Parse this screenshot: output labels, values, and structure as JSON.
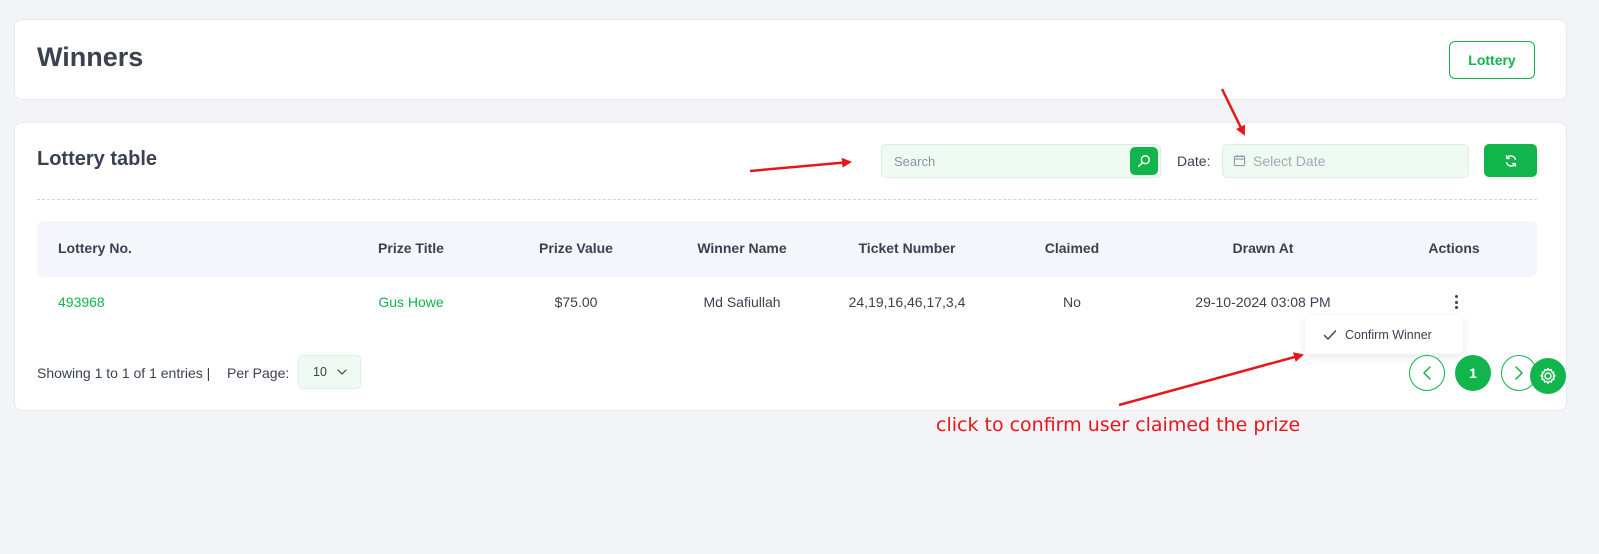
{
  "header": {
    "title": "Winners",
    "lottery_button": "Lottery"
  },
  "table_card": {
    "title": "Lottery table",
    "search_placeholder": "Search",
    "date_label": "Date:",
    "date_placeholder": "Select Date",
    "columns": [
      "Lottery No.",
      "Prize Title",
      "Prize Value",
      "Winner Name",
      "Ticket Number",
      "Claimed",
      "Drawn At",
      "Actions"
    ],
    "rows": [
      {
        "lottery_no": "493968",
        "prize_title": "Gus Howe",
        "prize_value": "$75.00",
        "winner_name": "Md Safiullah",
        "ticket_number": "24,19,16,46,17,3,4",
        "claimed": "No",
        "drawn_at": "29-10-2024 03:08 PM"
      }
    ],
    "action_menu": {
      "confirm_label": "Confirm Winner"
    },
    "footer": {
      "entries_text": "Showing 1 to 1 of 1 entries |",
      "per_page_label": "Per Page:",
      "per_page_value": "10",
      "current_page": "1"
    }
  },
  "annotation": {
    "text": "click to confirm user claimed the prize",
    "color": "#e8161a"
  },
  "colors": {
    "accent": "#12b44c",
    "background": "#f3f4f8"
  }
}
